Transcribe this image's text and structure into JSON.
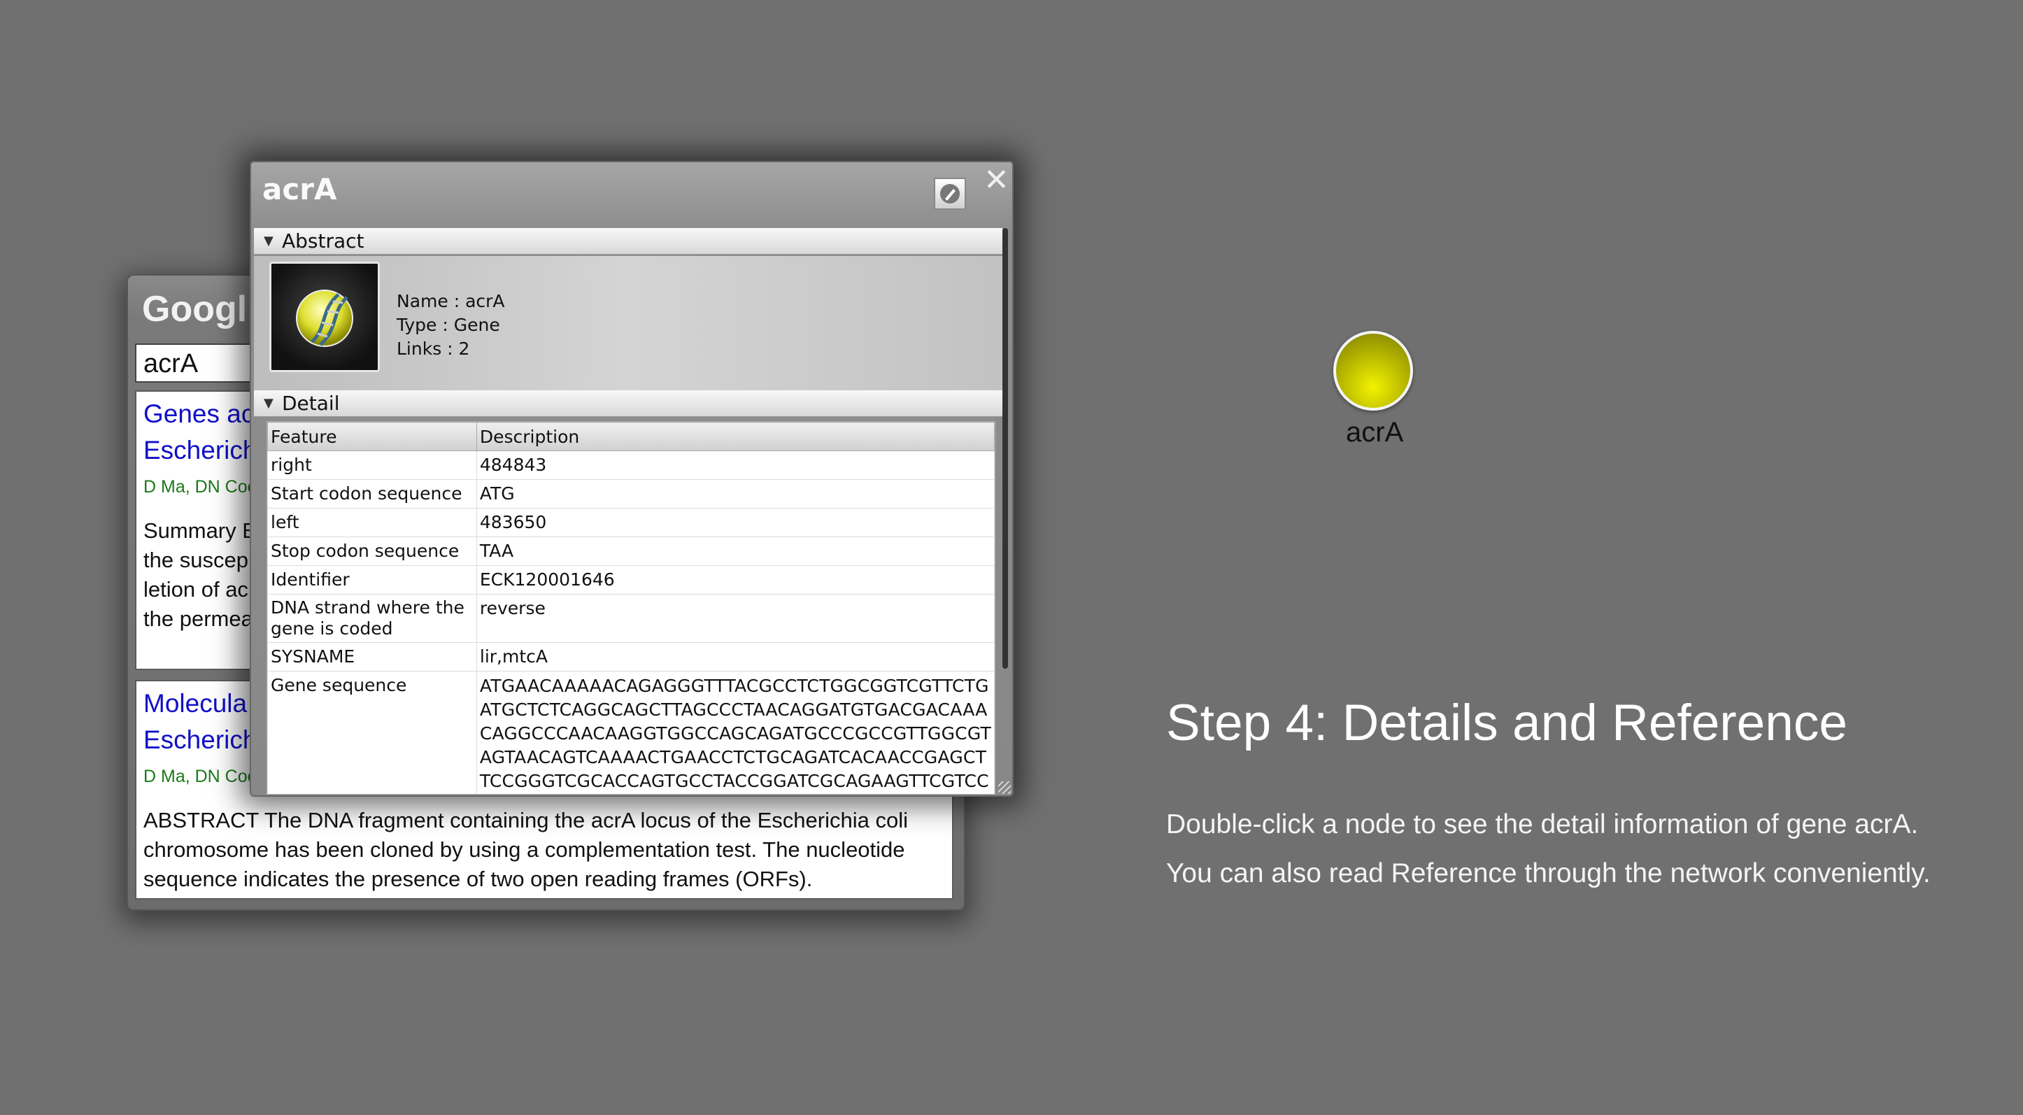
{
  "scholar": {
    "title": "Googl",
    "search_value": "acrA",
    "results": [
      {
        "title_lines": [
          "Genes ac",
          "Escherich"
        ],
        "authors": "D Ma, DN Coo",
        "snippet_lines": [
          "Summary E",
          "the suscep",
          "letion of ac",
          "the permea"
        ]
      },
      {
        "title_lines": [
          "Molecula",
          "Escherich"
        ],
        "authors": "D Ma, DN Coo",
        "snippet_lines": [
          "ABSTRACT The DNA fragment containing the acrA locus of the Escherichia coli",
          "chromosome has been cloned by using a complementation test. The nucleotide",
          "sequence indicates the presence of two open reading frames (ORFs)."
        ]
      }
    ]
  },
  "detail_window": {
    "title": "acrA",
    "close_glyph": "✕",
    "abstract": {
      "header": "Abstract",
      "name_line": "Name : acrA",
      "type_line": "Type : Gene",
      "links_line": "Links : 2"
    },
    "detail": {
      "header": "Detail",
      "columns": [
        "Feature",
        "Description"
      ],
      "rows": [
        {
          "feature": "right",
          "description": "484843"
        },
        {
          "feature": "Start codon sequence",
          "description": "ATG"
        },
        {
          "feature": "left",
          "description": "483650"
        },
        {
          "feature": "Stop codon sequence",
          "description": "TAA"
        },
        {
          "feature": "Identifier",
          "description": "ECK120001646"
        },
        {
          "feature": "DNA strand where the gene is coded",
          "description": "reverse"
        },
        {
          "feature": "SYSNAME",
          "description": "lir,mtcA"
        },
        {
          "feature": "Gene sequence",
          "description": "ATGAACAAAAACAGAGGGTTTACGCCTCTGGCGGTCGTTCTG\nATGCTCTCAGGCAGCTTAGCCCTAACAGGATGTGACGACAAA\nCAGGCCCAACAAGGTGGCCAGCAGATGCCCGCCGTTGGCGT\nAGTAACAGTCAAAACTGAACCTCTGCAGATCACAACCGAGCT\nTCCGGGTCGCACCAGTGCCTACCGGATCGCAGAAGTTCGTCC"
        }
      ]
    }
  },
  "node": {
    "label": "acrA",
    "color": "#d6d600"
  },
  "step": {
    "title": "Step 4: Details and Reference",
    "description": "Double-click a node to see the detail information of gene acrA. You can also read Reference through the network conveniently."
  }
}
